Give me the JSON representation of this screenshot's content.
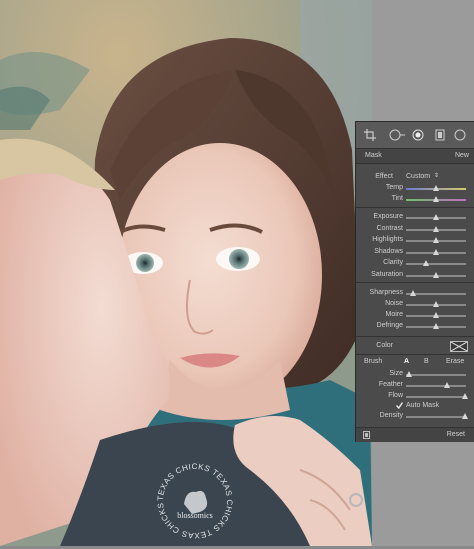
{
  "panel": {
    "header": {
      "left": "Mask",
      "right": "New"
    },
    "effect": {
      "label": "Effect",
      "value": "Custom"
    },
    "sliders_group1": [
      {
        "label": "Temp",
        "pos": 0.5,
        "style": "temp"
      },
      {
        "label": "Tint",
        "pos": 0.5,
        "style": "tint"
      }
    ],
    "sliders_group2": [
      {
        "label": "Exposure",
        "pos": 0.5
      },
      {
        "label": "Contrast",
        "pos": 0.5
      },
      {
        "label": "Highlights",
        "pos": 0.5
      },
      {
        "label": "Shadows",
        "pos": 0.5
      },
      {
        "label": "Clarity",
        "pos": 0.33
      },
      {
        "label": "Saturation",
        "pos": 0.5
      }
    ],
    "sliders_group3": [
      {
        "label": "Sharpness",
        "pos": 0.12
      },
      {
        "label": "Noise",
        "pos": 0.5
      },
      {
        "label": "Moire",
        "pos": 0.5
      },
      {
        "label": "Defringe",
        "pos": 0.5
      }
    ],
    "color_label": "Color",
    "brush": {
      "label": "Brush",
      "a": "A",
      "b": "B",
      "erase": "Erase"
    },
    "brush_sliders": [
      {
        "label": "Size",
        "pos": 0.05
      },
      {
        "label": "Feather",
        "pos": 0.68
      },
      {
        "label": "Flow",
        "pos": 0.98
      }
    ],
    "auto_mask": "Auto Mask",
    "density": {
      "label": "Density",
      "pos": 0.98
    },
    "reset": "Reset"
  },
  "watermark": {
    "ring_text": "TEXAS CHICKS TEXAS CHICKS TEXAS CHICKS",
    "center_text": "blossomics"
  },
  "colors": {
    "panel_bg": "#4b4b4b",
    "side_gray": "#9b9b9b"
  }
}
